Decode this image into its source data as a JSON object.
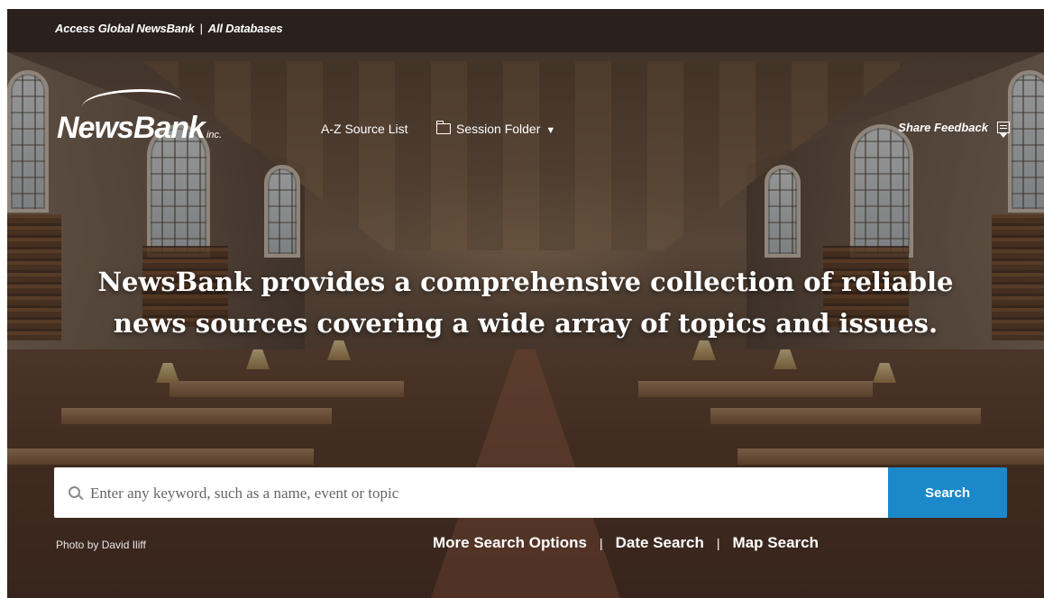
{
  "topbar": {
    "link1": "Access Global NewsBank",
    "link2": "All Databases"
  },
  "header": {
    "logo_text": "NewsBank",
    "logo_suffix": "inc.",
    "az_label": "A-Z Source List",
    "session_folder_label": "Session Folder",
    "feedback_label": "Share Feedback",
    "icons": [
      "folder-icon",
      "caret-down-icon",
      "feedback-icon"
    ]
  },
  "hero": {
    "headline_line1": "NewsBank provides a comprehensive collection of reliable",
    "headline_line2": "news sources covering a wide array of topics and issues.",
    "photo_credit": "Photo by David Iliff"
  },
  "search": {
    "placeholder": "Enter any keyword, such as a name, event or topic",
    "button_label": "Search",
    "icon": "search-icon"
  },
  "options": {
    "more": "More Search Options",
    "date": "Date Search",
    "map": "Map Search",
    "separator": "|"
  },
  "colors": {
    "topbar_bg": "#2a211d",
    "search_button": "#1b88c9",
    "text": "#ffffff"
  }
}
